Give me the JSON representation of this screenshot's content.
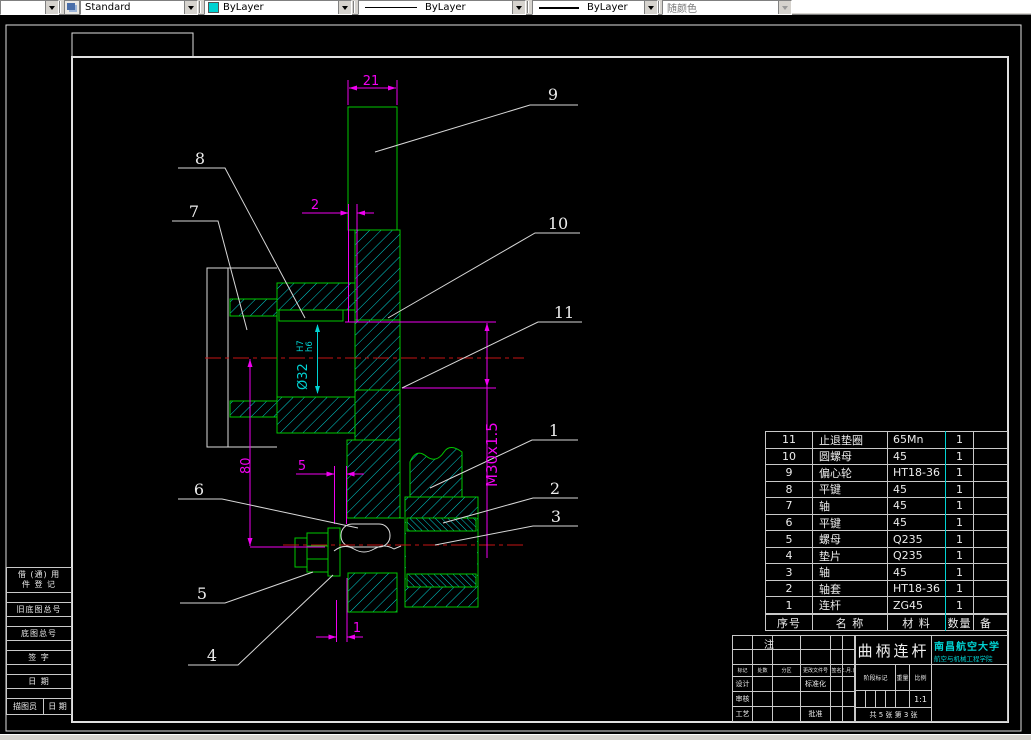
{
  "toolbar": {
    "layer_combo": "",
    "style_combo": "Standard",
    "color_combo": "ByLayer",
    "linetype_combo": "ByLayer",
    "lineweight_combo": "ByLayer",
    "plotstyle_combo": "随颜色"
  },
  "drawing": {
    "balloons": [
      "1",
      "2",
      "3",
      "4",
      "5",
      "6",
      "7",
      "8",
      "9",
      "10",
      "11"
    ],
    "dims": {
      "top_width": "21",
      "gap": "2",
      "bore_dia": "Ø32",
      "bore_fit_upper": "H7",
      "bore_fit_lower": "h6",
      "offset": "80",
      "key_offset": "5",
      "thread": "M30x1.5",
      "washer_thickness": "1"
    }
  },
  "parts_table": {
    "header": {
      "no": "序号",
      "name": "名  称",
      "material": "材  料",
      "qty": "数量",
      "remark": "备"
    },
    "rows": [
      {
        "no": "11",
        "name": "止退垫圈",
        "material": "65Mn",
        "qty": "1",
        "remark": ""
      },
      {
        "no": "10",
        "name": "圆螺母",
        "material": "45",
        "qty": "1",
        "remark": ""
      },
      {
        "no": "9",
        "name": "偏心轮",
        "material": "HT18-36",
        "qty": "1",
        "remark": ""
      },
      {
        "no": "8",
        "name": "平键",
        "material": "45",
        "qty": "1",
        "remark": ""
      },
      {
        "no": "7",
        "name": "轴",
        "material": "45",
        "qty": "1",
        "remark": ""
      },
      {
        "no": "6",
        "name": "平键",
        "material": "45",
        "qty": "1",
        "remark": ""
      },
      {
        "no": "5",
        "name": "螺母",
        "material": "Q235",
        "qty": "1",
        "remark": ""
      },
      {
        "no": "4",
        "name": "垫片",
        "material": "Q235",
        "qty": "1",
        "remark": ""
      },
      {
        "no": "3",
        "name": "轴",
        "material": "45",
        "qty": "1",
        "remark": ""
      },
      {
        "no": "2",
        "name": "轴套",
        "material": "HT18-36",
        "qty": "1",
        "remark": ""
      },
      {
        "no": "1",
        "name": "连杆",
        "material": "ZG45",
        "qty": "1",
        "remark": ""
      }
    ]
  },
  "note_label": "注",
  "title_block": {
    "title": "曲柄连杆",
    "org_line1": "南昌航空大学",
    "org_line2": "航空与机械工程学院",
    "scale_value": "1:1",
    "sheet_info": "共 5 张  第 3 张",
    "labels": {
      "mark": "标记",
      "count": "处数",
      "zone": "分区",
      "file_no": "更改文件号",
      "sign": "签名",
      "date": "年.月.日",
      "design": "设计",
      "standardize": "标准化",
      "review": "审核",
      "process": "工艺",
      "approve": "批准",
      "stage_mark": "阶段标记",
      "weight": "重量",
      "scale": "比例"
    }
  },
  "left_strip": {
    "rows": [
      {
        "text": "借 (通) 用\n件 登 记"
      },
      {
        "text": ""
      },
      {
        "text": "旧底图总号"
      },
      {
        "text": ""
      },
      {
        "text": "底图总号"
      },
      {
        "text": ""
      },
      {
        "text": "签  字"
      },
      {
        "text": ""
      },
      {
        "text": "日  期"
      },
      {
        "text": ""
      }
    ],
    "bottom_left": "描图员",
    "bottom_right": "日 期"
  },
  "colors": {
    "line_green": "#00c800",
    "hatch_cyan": "#00d2d2",
    "dim_magenta": "#f000f0",
    "centerline_red": "#c41414",
    "line_white": "#dcdcdc"
  }
}
